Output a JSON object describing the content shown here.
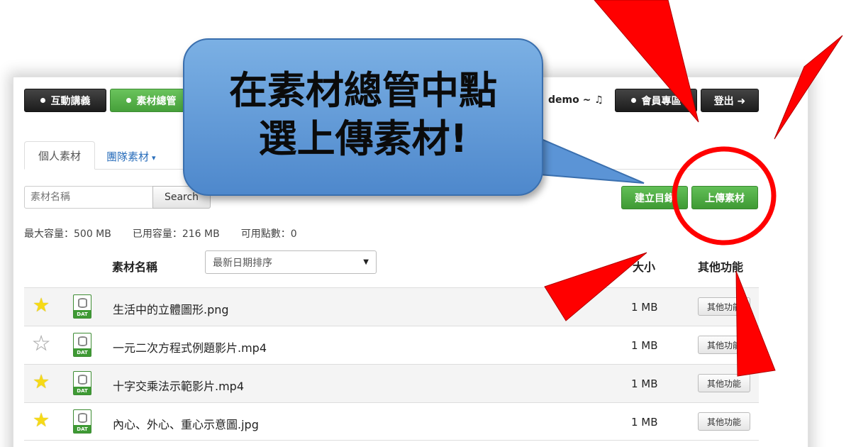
{
  "nav": {
    "buttons": [
      {
        "label": "互動講義",
        "active": false
      },
      {
        "label": "素材總管",
        "active": true
      }
    ],
    "username": "demo ~ ♫",
    "member_label": "會員專區",
    "logout_label": "登出 ➜"
  },
  "tabs": {
    "personal": "個人素材",
    "team": "團隊素材",
    "team_caret": "▾"
  },
  "search": {
    "placeholder": "素材名稱",
    "button_label": "Search"
  },
  "actions": {
    "create_folder": "建立目錄",
    "upload": "上傳素材"
  },
  "quota": {
    "max": "最大容量：500 MB",
    "used": "已用容量：216 MB",
    "points": "可用點數：0"
  },
  "table": {
    "col_name": "素材名稱",
    "sort_selected": "最新日期排序",
    "col_size": "大小",
    "col_more": "其他功能",
    "file_icon_label": "DAT",
    "rows": [
      {
        "starred": true,
        "name": "生活中的立體圖形.png",
        "size": "1 MB",
        "more": "其他功能"
      },
      {
        "starred": false,
        "name": "一元二次方程式例題影片.mp4",
        "size": "1 MB",
        "more": "其他功能"
      },
      {
        "starred": true,
        "name": "十字交乘法示範影片.mp4",
        "size": "1 MB",
        "more": "其他功能"
      },
      {
        "starred": true,
        "name": "內心、外心、重心示意圖.jpg",
        "size": "1 MB",
        "more": "其他功能"
      }
    ]
  },
  "callout": {
    "line1": "在素材總管中點",
    "line2": "選上傳素材!"
  },
  "colors": {
    "annotation_red": "#ff0000",
    "callout_blue": "#5b94d6",
    "action_green": "#4caf42"
  }
}
